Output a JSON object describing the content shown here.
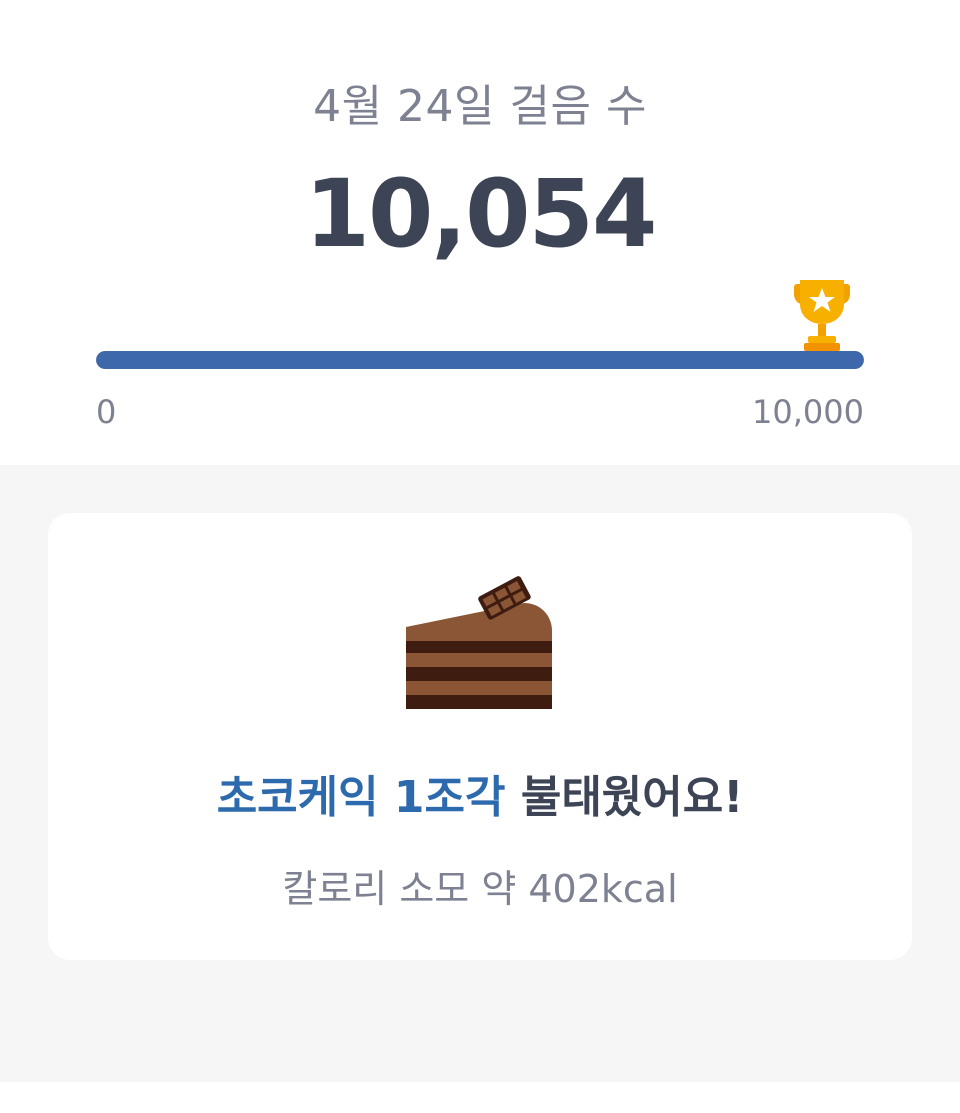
{
  "header": {
    "date_label": "4월 24일 걸음 수",
    "steps": "10,054"
  },
  "progress": {
    "min_label": "0",
    "max_label": "10,000",
    "fraction": 1.0,
    "goal_icon": "trophy-icon",
    "fill_color": "#3d69aa"
  },
  "reward": {
    "icon": "chocolate-cake-icon",
    "food_text": "초코케익 1조각",
    "suffix_text": " 불태웠어요!",
    "calorie_text": "칼로리 소모 약 402kcal",
    "accent_color": "#2d6aad"
  }
}
